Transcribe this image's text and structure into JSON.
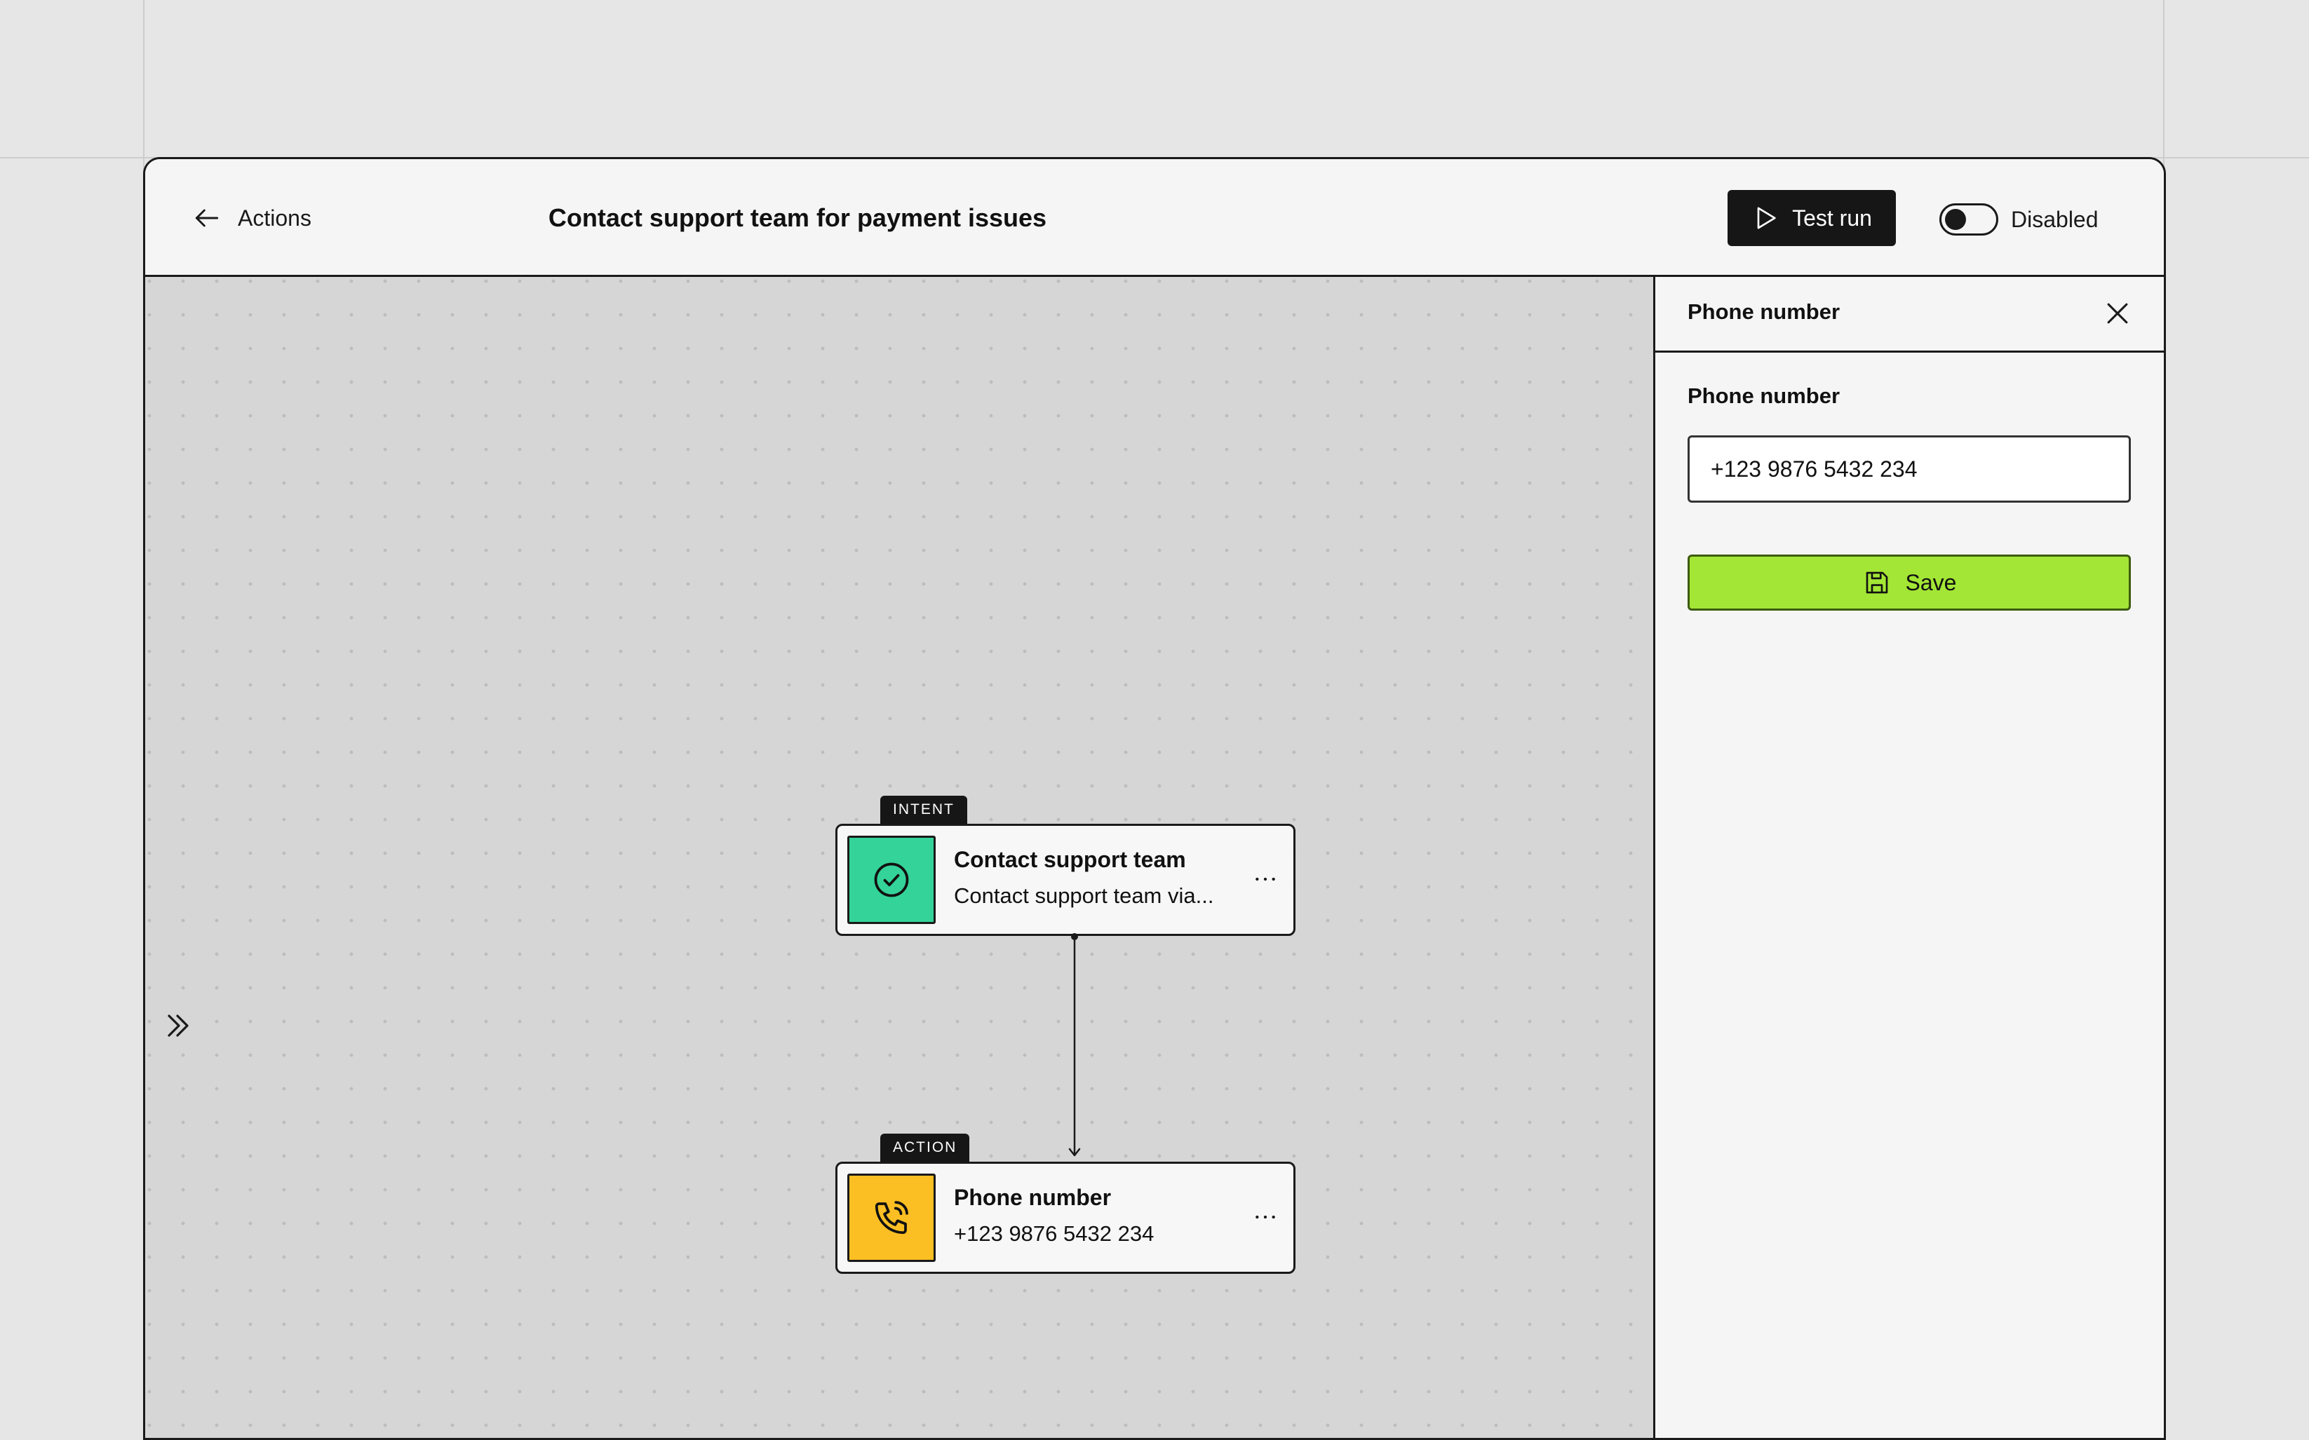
{
  "header": {
    "back_label": "Actions",
    "title": "Contact support team for payment issues",
    "test_run_label": "Test run",
    "toggle_label": "Disabled",
    "toggle_on": false
  },
  "canvas": {
    "nodes": [
      {
        "tag": "INTENT",
        "title": "Contact support team",
        "subtitle": "Contact support team via...",
        "icon": "check-circle-icon",
        "icon_color": "#34d399"
      },
      {
        "tag": "ACTION",
        "title": "Phone number",
        "subtitle": "+123 9876 5432 234",
        "icon": "phone-call-icon",
        "icon_color": "#fbbf24"
      }
    ]
  },
  "panel": {
    "title": "Phone number",
    "field_label": "Phone number",
    "field_value": "+123 9876 5432 234",
    "save_label": "Save",
    "save_color": "#a3e635"
  }
}
